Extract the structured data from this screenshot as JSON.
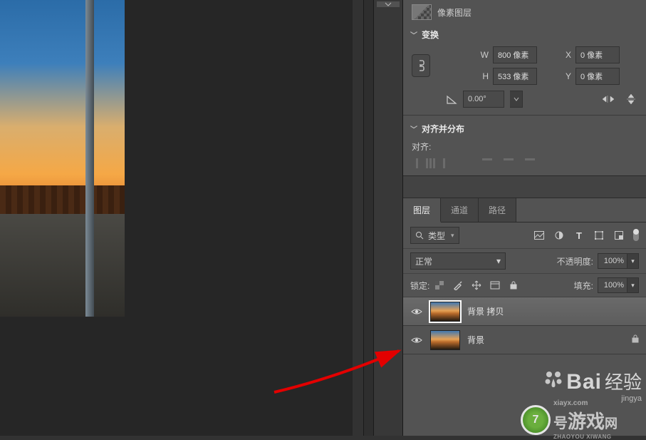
{
  "properties": {
    "pixel_layer_label": "像素图层",
    "transform_header": "变换",
    "w_label": "W",
    "h_label": "H",
    "x_label": "X",
    "y_label": "Y",
    "w_value": "800 像素",
    "h_value": "533 像素",
    "x_value": "0 像素",
    "y_value": "0 像素",
    "rotation_value": "0.00°",
    "align_header": "对齐并分布",
    "align_label": "对齐:"
  },
  "layers_panel": {
    "tabs": {
      "layers": "图层",
      "channels": "通道",
      "paths": "路径"
    },
    "type_filter_label": "类型",
    "blend_mode": "正常",
    "opacity_label": "不透明度:",
    "opacity_value": "100%",
    "lock_label": "锁定:",
    "fill_label": "填充:",
    "fill_value": "100%",
    "layers": [
      {
        "name": "背景 拷贝",
        "selected": true,
        "locked": false
      },
      {
        "name": "背景",
        "selected": false,
        "locked": true
      }
    ]
  },
  "watermark": {
    "baidu": "Bai",
    "exp": "经验",
    "url": "jingya",
    "game_site": "游戏",
    "game_num": "7",
    "game_url": "xiayx.com",
    "game_sub": "ZHAOYOU XIWANG"
  }
}
